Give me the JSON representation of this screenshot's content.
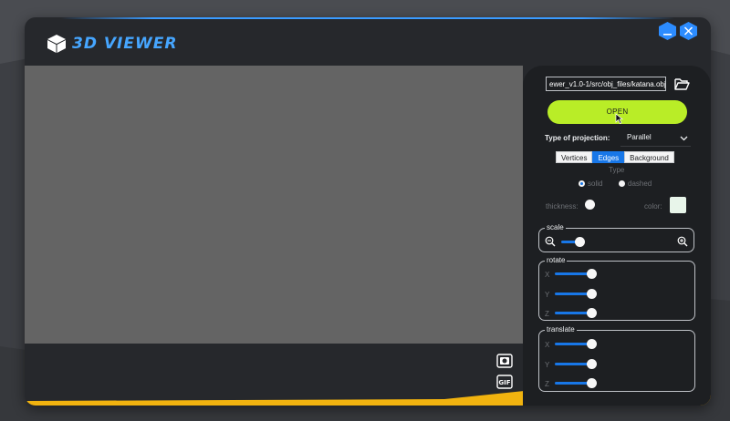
{
  "app": {
    "title": "3D VIEWER",
    "icons": [
      "cube-icon",
      "minimize-icon",
      "close-icon",
      "folder-open-icon",
      "camera-icon",
      "gif-icon",
      "zoom-out-icon",
      "zoom-in-icon",
      "chevron-down-icon"
    ]
  },
  "file": {
    "path": "ewer_v1.0-1/src/obj_files/katana.obj",
    "open_label": "OPEN"
  },
  "projection": {
    "label": "Type of projection:",
    "value": "Parallel"
  },
  "tabs": [
    {
      "label": "Vertices",
      "active": false
    },
    {
      "label": "Edges",
      "active": true
    },
    {
      "label": "Background",
      "active": false
    }
  ],
  "edges": {
    "type_label": "Type",
    "type_options": [
      {
        "label": "solid",
        "selected": true
      },
      {
        "label": "dashed",
        "selected": false
      }
    ],
    "thickness_label": "thickness:",
    "thickness_value": 0,
    "color_label": "color:",
    "color_value": "#e8f5ea"
  },
  "scale": {
    "label": "scale",
    "value": 0.5
  },
  "rotate": {
    "label": "rotate",
    "axes": [
      {
        "label": "X",
        "value": 0.5
      },
      {
        "label": "Y",
        "value": 0.5
      },
      {
        "label": "Z",
        "value": 0.5
      }
    ]
  },
  "translate": {
    "label": "translate",
    "axes": [
      {
        "label": "X",
        "value": 0.5
      },
      {
        "label": "Y",
        "value": 0.5
      },
      {
        "label": "Z",
        "value": 0.5
      }
    ]
  },
  "colors": {
    "accent_blue": "#1877e8",
    "open_green": "#b9ed27",
    "yellow_accent": "#f1b30f",
    "title_blue": "#46a6ff"
  }
}
